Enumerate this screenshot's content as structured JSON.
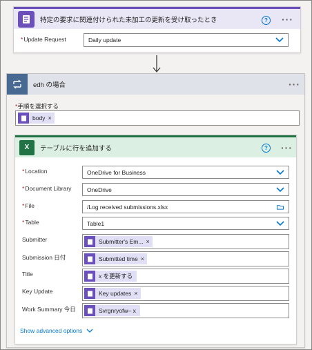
{
  "trigger": {
    "title": "特定の要求に関連付けられた未加工の更新を受け取ったとき",
    "field_label": "Update Request",
    "field_value": "Daily update",
    "required_mark": "*"
  },
  "condition": {
    "title": "edh の場合",
    "choose_label": "手順を選択する",
    "token": "body"
  },
  "excel": {
    "title": "テーブルに行を追加する",
    "fields": [
      {
        "label": "Location",
        "required": true,
        "value": "OneDrive for Business",
        "kind": "dropdown"
      },
      {
        "label": "Document Library",
        "required": true,
        "value": "OneDrive",
        "kind": "dropdown"
      },
      {
        "label": "File",
        "required": true,
        "value": "/Log received submissions.xlsx",
        "kind": "file"
      },
      {
        "label": "Table",
        "required": true,
        "value": "Table1",
        "kind": "dropdown"
      },
      {
        "label": "Submitter",
        "required": false,
        "token": "Submitter's Em...",
        "kind": "token"
      },
      {
        "label": "Submission 日付",
        "required": false,
        "token": "Submitted time",
        "kind": "token"
      },
      {
        "label": "Title",
        "required": false,
        "token": "x を更新する",
        "kind": "token"
      },
      {
        "label": "Key Update",
        "required": false,
        "token": "Key updates",
        "kind": "token"
      },
      {
        "label": "Work Summary 今日",
        "required": false,
        "token": "Svrgnryofw– x",
        "kind": "token"
      }
    ],
    "advanced_options": "Show advanced options"
  },
  "icons": {
    "help": "?",
    "more": "···",
    "token_close": "×"
  },
  "colors": {
    "purple": "#6b4fbb",
    "excel_green": "#217346",
    "condition_blue": "#486991",
    "link": "#0078d4"
  }
}
